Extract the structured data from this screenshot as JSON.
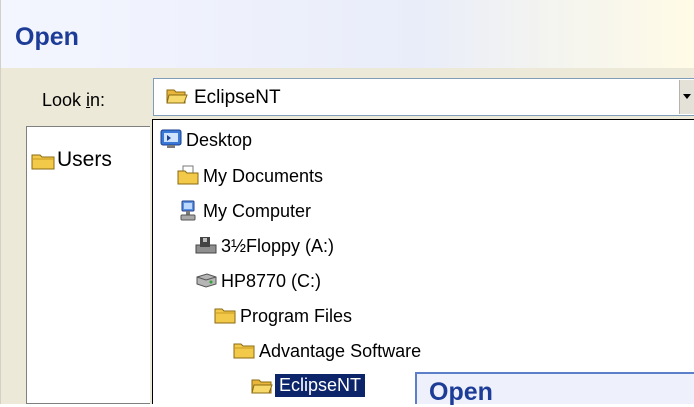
{
  "window": {
    "title": "Open"
  },
  "look_in": {
    "label_prefix": "Look ",
    "label_underlined": "i",
    "label_suffix": "n:",
    "selected_value": "EclipseNT",
    "selected_icon": "folder-open-icon"
  },
  "left_pane": {
    "items": [
      {
        "label": "Users",
        "icon": "folder-icon"
      }
    ]
  },
  "dropdown": {
    "items": [
      {
        "label": "Desktop",
        "icon": "desktop-icon",
        "level": 0
      },
      {
        "label": "My Documents",
        "icon": "documents-folder-icon",
        "level": 1
      },
      {
        "label": "My Computer",
        "icon": "computer-icon",
        "level": 1
      },
      {
        "label": "3½Floppy (A:)",
        "icon": "floppy-drive-icon",
        "level": 2
      },
      {
        "label": "HP8770 (C:)",
        "icon": "hard-drive-icon",
        "level": 2
      },
      {
        "label": "Program Files",
        "icon": "folder-icon",
        "level": 3
      },
      {
        "label": "Advantage Software",
        "icon": "folder-icon",
        "level": 4
      },
      {
        "label": "EclipseNT",
        "icon": "folder-open-icon",
        "level": 5,
        "selected": true
      }
    ]
  },
  "overlap_window": {
    "title": "Open"
  },
  "colors": {
    "title_text": "#1c3c97",
    "selection": "#0b246a",
    "folder": "#f3c949"
  }
}
